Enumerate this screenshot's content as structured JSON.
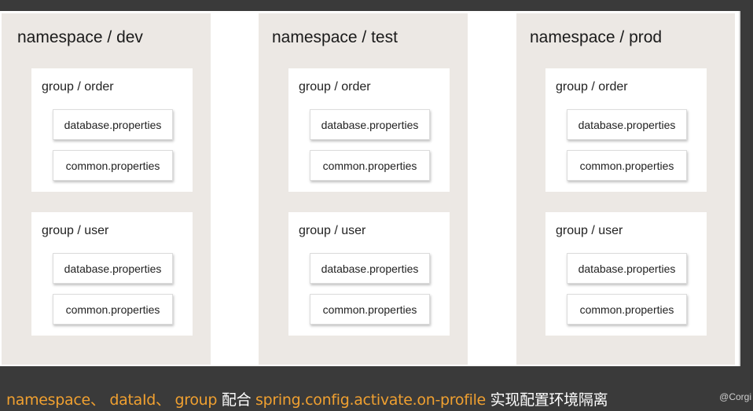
{
  "top_text": "",
  "namespaces": [
    {
      "title": "namespace / dev",
      "groups": [
        {
          "title": "group / order",
          "files": [
            "database.properties",
            "common.properties"
          ]
        },
        {
          "title": "group / user",
          "files": [
            "database.properties",
            "common.properties"
          ]
        }
      ]
    },
    {
      "title": "namespace / test",
      "groups": [
        {
          "title": "group / order",
          "files": [
            "database.properties",
            "common.properties"
          ]
        },
        {
          "title": "group / user",
          "files": [
            "database.properties",
            "common.properties"
          ]
        }
      ]
    },
    {
      "title": "namespace / prod",
      "groups": [
        {
          "title": "group / order",
          "files": [
            "database.properties",
            "common.properties"
          ]
        },
        {
          "title": "group / user",
          "files": [
            "database.properties",
            "common.properties"
          ]
        }
      ]
    }
  ],
  "caption": {
    "part1": "namespace、 dataId、 group ",
    "part2": "配合",
    "part3": " spring.config.activate.on-profile ",
    "part4": "实现配置环境隔离"
  },
  "watermark": "@Corgi",
  "colors": {
    "background": "#3a3a3a",
    "namespace_panel": "#ece8e4",
    "caption_orange": "#f0a030",
    "caption_white": "#ffffff"
  }
}
